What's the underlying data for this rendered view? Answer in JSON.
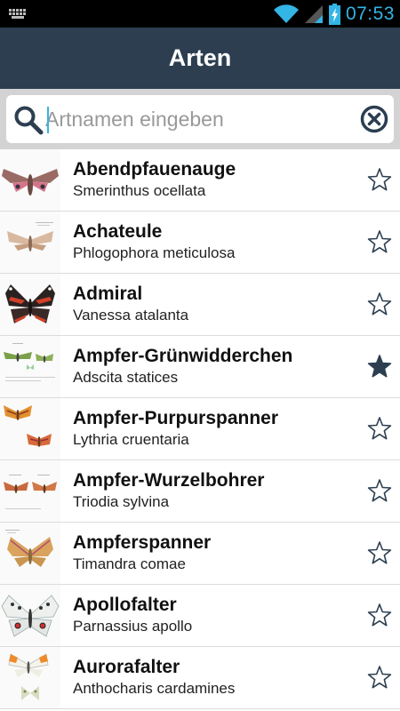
{
  "status": {
    "time": "07:53",
    "icons": [
      "keyboard-icon",
      "wifi-icon",
      "signal-icon",
      "battery-charging-icon"
    ],
    "accent": "#33b5e5"
  },
  "header": {
    "title": "Arten",
    "background": "#2c3e50"
  },
  "search": {
    "placeholder": "Artnamen eingeben",
    "value": ""
  },
  "species": [
    {
      "common": "Abendpfauenauge",
      "scientific": "Smerinthus ocellata",
      "favorite": false,
      "thumb": "moth-pink"
    },
    {
      "common": "Achateule",
      "scientific": "Phlogophora meticulosa",
      "favorite": false,
      "thumb": "moth-tan"
    },
    {
      "common": "Admiral",
      "scientific": "Vanessa atalanta",
      "favorite": false,
      "thumb": "butterfly-red"
    },
    {
      "common": "Ampfer-Grünwidderchen",
      "scientific": "Adscita statices",
      "favorite": true,
      "thumb": "moth-green"
    },
    {
      "common": "Ampfer-Purpurspanner",
      "scientific": "Lythria cruentaria",
      "favorite": false,
      "thumb": "moth-orange"
    },
    {
      "common": "Ampfer-Wurzelbohrer",
      "scientific": "Triodia sylvina",
      "favorite": false,
      "thumb": "moth-rust"
    },
    {
      "common": "Ampferspanner",
      "scientific": "Timandra comae",
      "favorite": false,
      "thumb": "moth-ochre"
    },
    {
      "common": "Apollofalter",
      "scientific": "Parnassius apollo",
      "favorite": false,
      "thumb": "butterfly-white"
    },
    {
      "common": "Aurorafalter",
      "scientific": "Anthocharis cardamines",
      "favorite": false,
      "thumb": "butterfly-orange-tip"
    }
  ]
}
